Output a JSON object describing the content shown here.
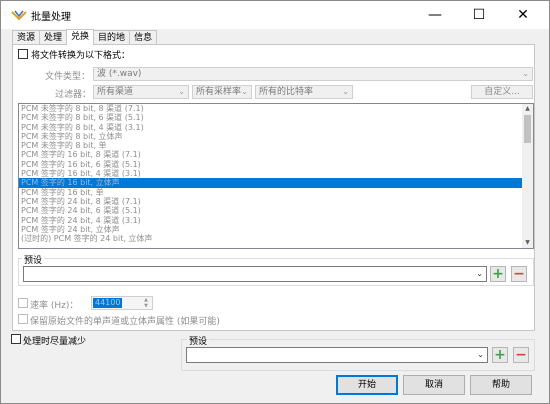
{
  "window": {
    "title": "批量处理"
  },
  "titlebar": {
    "minimize": "—",
    "maximize": "☐",
    "close": "✕"
  },
  "tabs": [
    {
      "label": "资源"
    },
    {
      "label": "处理"
    },
    {
      "label": "兑换"
    },
    {
      "label": "目的地"
    },
    {
      "label": "信息"
    }
  ],
  "convert": {
    "checkbox_label": "将文件转换为以下格式：",
    "file_type_label": "文件类型：",
    "file_type_value": "波 (*.wav)",
    "filter_label": "过滤器：",
    "filter_channels": "所有渠道",
    "filter_samplerate": "所有采样率",
    "filter_bitrate": "所有的比特率",
    "custom_button": "自定义..."
  },
  "formats": [
    "PCM 未签字的 8 bit, 8 渠道 (7.1)",
    "PCM 未签字的 8 bit, 6 渠道 (5.1)",
    "PCM 未签字的 8 bit, 4 渠道 (3.1)",
    "PCM 未签字的 8 bit, 立体声",
    "PCM 未签字的 8 bit, 单",
    "PCM 签字的 16 bit, 8 渠道 (7.1)",
    "PCM 签字的 16 bit, 6 渠道 (5.1)",
    "PCM 签字的 16 bit, 4 渠道 (3.1)",
    "PCM 签字的 16 bit, 立体声",
    "PCM 签字的 16 bit, 单",
    "PCM 签字的 24 bit, 8 渠道 (7.1)",
    "PCM 签字的 24 bit, 6 渠道 (5.1)",
    "PCM 签字的 24 bit, 4 渠道 (3.1)",
    "PCM 签字的 24 bit, 立体声",
    "(过时的) PCM 签字的 24 bit, 立体声"
  ],
  "selected_format_index": 8,
  "preset_top": {
    "label": "预设",
    "value": ""
  },
  "rate": {
    "label": "速率 (Hz)：",
    "value": "44100"
  },
  "preserve": {
    "label": "保留原始文件的单声道或立体声属性 (如果可能)"
  },
  "reduce": {
    "label": "处理时尽量减少"
  },
  "preset_bottom": {
    "label": "预设",
    "value": ""
  },
  "buttons": {
    "start": "开始",
    "cancel": "取消",
    "help": "帮助"
  },
  "icons": {
    "add": "+",
    "remove": "−",
    "dropdown": "⌄",
    "spin": "▲▼"
  },
  "colors": {
    "selection": "#0078d7",
    "add": "#3aa24a",
    "remove": "#d64040"
  }
}
